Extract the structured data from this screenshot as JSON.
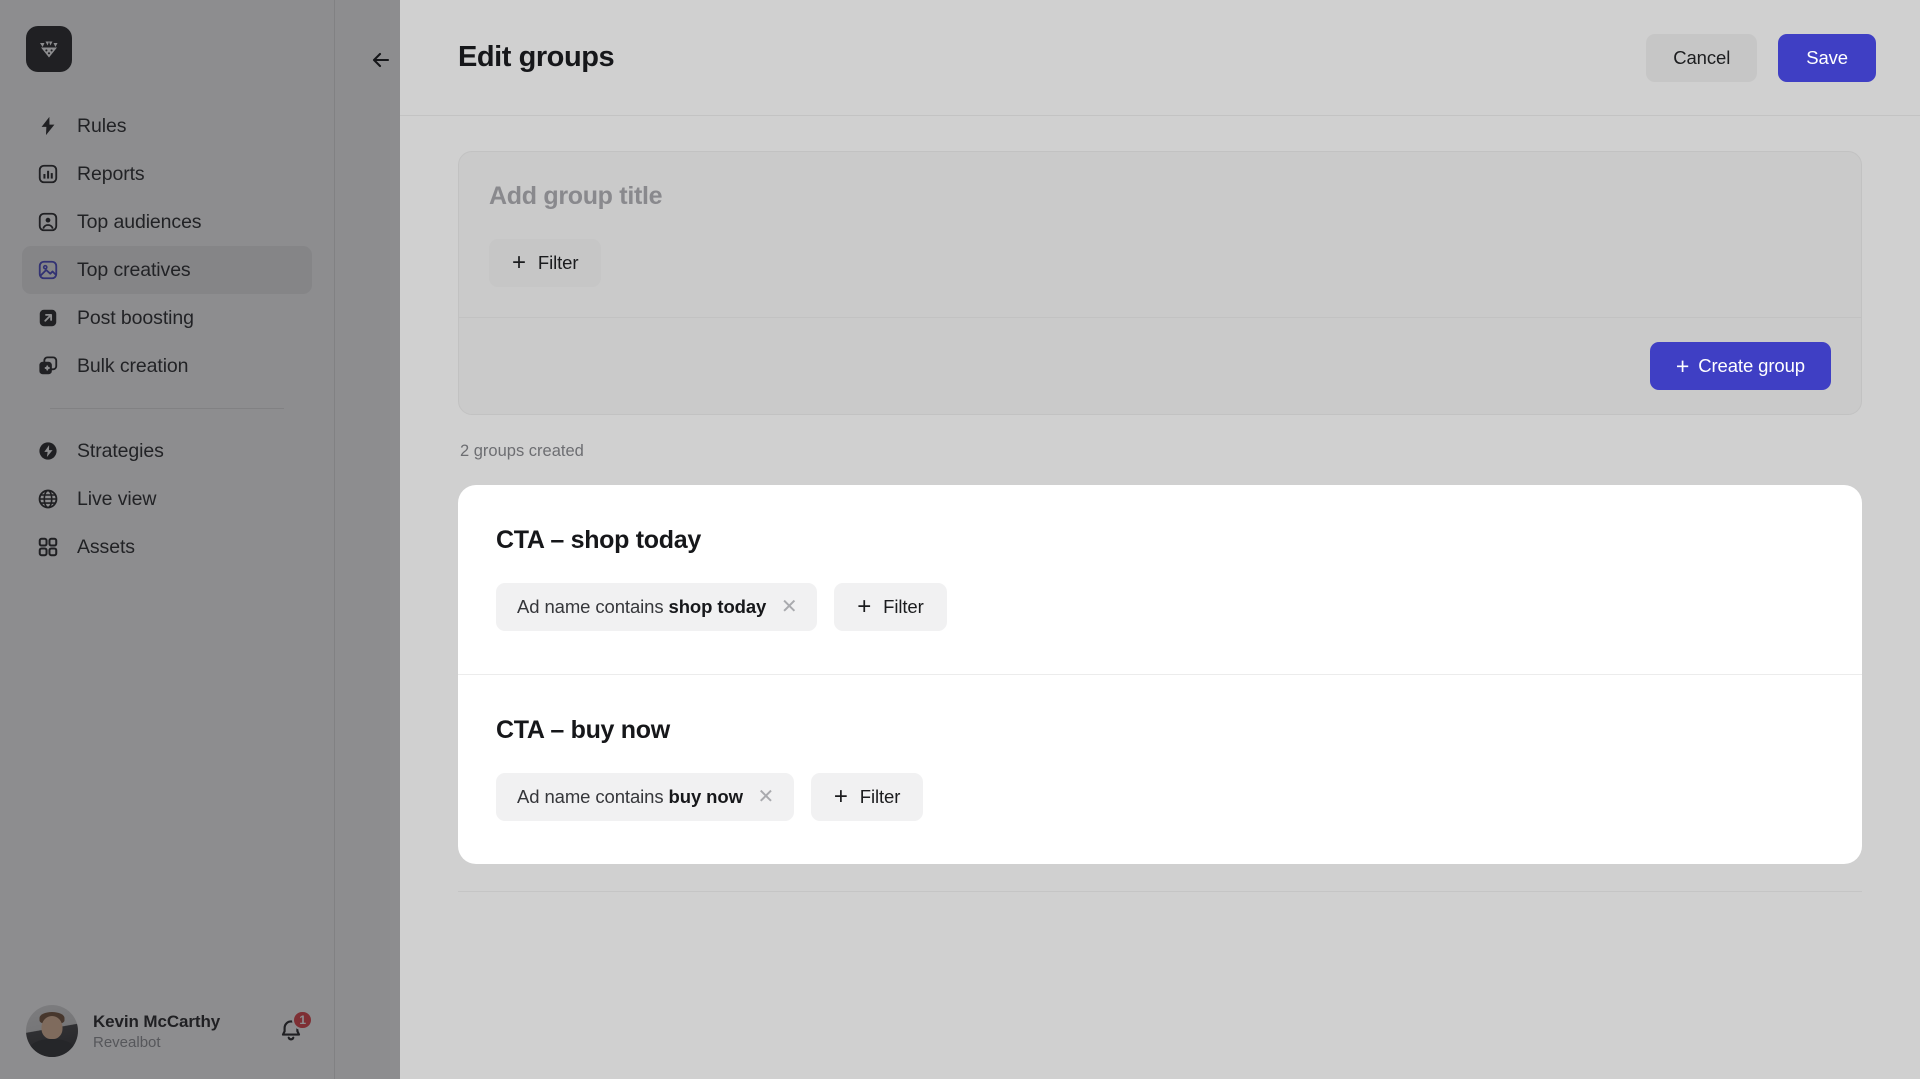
{
  "sidebar": {
    "logo_icon": "revealbot-logo-icon",
    "items": [
      {
        "label": "Rules",
        "icon": "bolt-icon",
        "active": false
      },
      {
        "label": "Reports",
        "icon": "bar-chart-icon",
        "active": false
      },
      {
        "label": "Top audiences",
        "icon": "user-square-icon",
        "active": false
      },
      {
        "label": "Top creatives",
        "icon": "image-icon",
        "active": true
      },
      {
        "label": "Post boosting",
        "icon": "arrow-up-right-square-icon",
        "active": false
      },
      {
        "label": "Bulk creation",
        "icon": "plus-squares-icon",
        "active": false
      }
    ],
    "items_secondary": [
      {
        "label": "Strategies",
        "icon": "bolt-circle-icon",
        "active": false
      },
      {
        "label": "Live view",
        "icon": "globe-icon",
        "active": false
      },
      {
        "label": "Assets",
        "icon": "grid-icon",
        "active": false
      }
    ],
    "profile": {
      "name": "Kevin McCarthy",
      "org": "Revealbot",
      "avatar_icon": "avatar",
      "bell_icon": "bell-icon",
      "notification_count": "1"
    }
  },
  "overlay": {
    "back_icon": "arrow-left-icon"
  },
  "panel": {
    "title": "Edit groups",
    "cancel_label": "Cancel",
    "save_label": "Save",
    "builder": {
      "title_value": "",
      "title_placeholder": "Add group title",
      "filter_label": "Filter",
      "filter_icon": "plus-icon",
      "create_label": "Create group",
      "create_icon": "plus-icon"
    },
    "groups_count_label": "2 groups created",
    "groups": [
      {
        "name": "CTA – shop today",
        "token": {
          "prefix": "Ad name contains",
          "value": "shop today",
          "remove_icon": "close-icon"
        },
        "filter_label": "Filter",
        "filter_icon": "plus-icon"
      },
      {
        "name": "CTA – buy now",
        "token": {
          "prefix": "Ad name contains",
          "value": "buy now",
          "remove_icon": "close-icon"
        },
        "filter_label": "Filter",
        "filter_icon": "plus-icon"
      }
    ]
  },
  "colors": {
    "accent": "#3f3fc4",
    "panel_bg": "#d0d0d0",
    "card_bg": "#ffffff",
    "badge": "#e0393e",
    "active_nav_icon": "#3f3fc4"
  }
}
